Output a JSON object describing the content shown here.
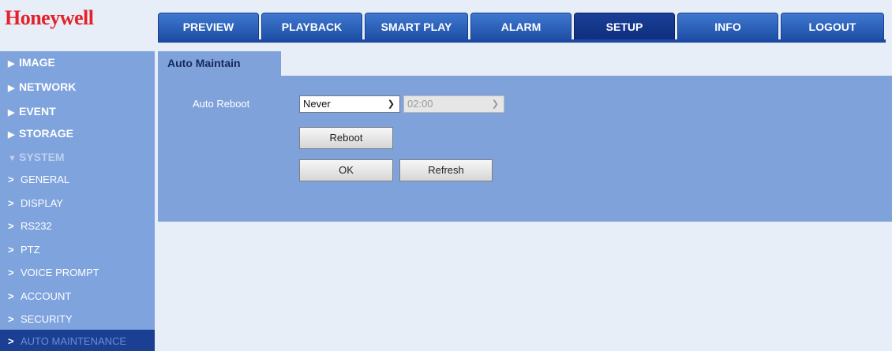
{
  "brand": {
    "logo_text": "Honeywell",
    "logo_color": "#e3222a"
  },
  "nav": {
    "tabs": [
      {
        "label": "PREVIEW"
      },
      {
        "label": "PLAYBACK"
      },
      {
        "label": "SMART PLAY"
      },
      {
        "label": "ALARM"
      },
      {
        "label": "SETUP",
        "active": true
      },
      {
        "label": "INFO"
      },
      {
        "label": "LOGOUT"
      }
    ]
  },
  "sidebar": {
    "sections": [
      {
        "label": "IMAGE",
        "icon": "triangle-right-icon"
      },
      {
        "label": "NETWORK",
        "icon": "triangle-right-icon"
      },
      {
        "label": "EVENT",
        "icon": "triangle-right-icon"
      },
      {
        "label": "STORAGE",
        "icon": "triangle-right-icon"
      },
      {
        "label": "SYSTEM",
        "icon": "triangle-down-icon",
        "expanded": true
      }
    ],
    "system_items": [
      {
        "label": "GENERAL"
      },
      {
        "label": "DISPLAY"
      },
      {
        "label": "RS232"
      },
      {
        "label": "PTZ"
      },
      {
        "label": "VOICE PROMPT"
      },
      {
        "label": "ACCOUNT"
      },
      {
        "label": "SECURITY"
      },
      {
        "label": "AUTO MAINTENANCE",
        "active": true
      }
    ]
  },
  "main": {
    "tab_title": "Auto Maintain",
    "auto_reboot": {
      "label": "Auto Reboot",
      "frequency_value": "Never",
      "time_value": "02:00"
    },
    "buttons": {
      "reboot": "Reboot",
      "ok": "OK",
      "refresh": "Refresh"
    }
  },
  "colors": {
    "nav_active": "#0f2f7e",
    "nav_tab": "#2e63bd",
    "sidebar_bg": "#7ea3dd",
    "panel_bg": "#80a2db",
    "page_bg": "#e8eef7"
  }
}
